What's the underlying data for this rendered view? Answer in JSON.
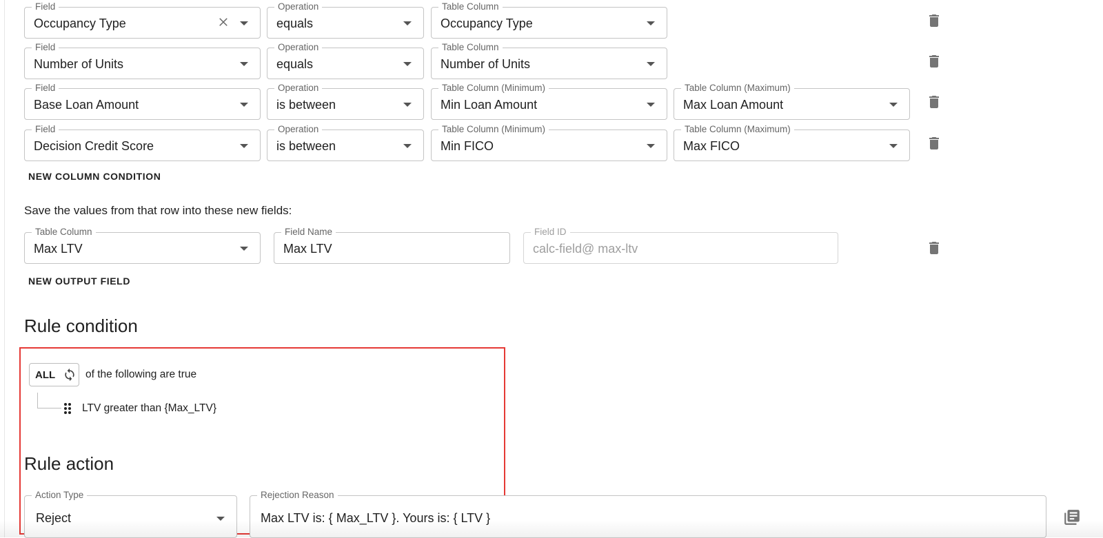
{
  "column_conditions": [
    {
      "field": {
        "label": "Field",
        "value": "Occupancy Type"
      },
      "operation": {
        "label": "Operation",
        "value": "equals"
      },
      "column": {
        "label": "Table Column",
        "value": "Occupancy Type"
      }
    },
    {
      "field": {
        "label": "Field",
        "value": "Number of Units"
      },
      "operation": {
        "label": "Operation",
        "value": "equals"
      },
      "column": {
        "label": "Table Column",
        "value": "Number of Units"
      }
    },
    {
      "field": {
        "label": "Field",
        "value": "Base Loan Amount"
      },
      "operation": {
        "label": "Operation",
        "value": "is between"
      },
      "column_min": {
        "label": "Table Column (Minimum)",
        "value": "Min Loan Amount"
      },
      "column_max": {
        "label": "Table Column (Maximum)",
        "value": "Max Loan Amount"
      }
    },
    {
      "field": {
        "label": "Field",
        "value": "Decision Credit Score"
      },
      "operation": {
        "label": "Operation",
        "value": "is between"
      },
      "column_min": {
        "label": "Table Column (Minimum)",
        "value": "Min FICO"
      },
      "column_max": {
        "label": "Table Column (Maximum)",
        "value": "Max FICO"
      }
    }
  ],
  "new_column_condition_label": "NEW COLUMN CONDITION",
  "save_values_text": "Save the values from that row into these new fields:",
  "output_field": {
    "column": {
      "label": "Table Column",
      "value": "Max LTV"
    },
    "field_name": {
      "label": "Field Name",
      "value": "Max LTV"
    },
    "field_id": {
      "label": "Field ID",
      "value": "calc-field@  max-ltv"
    }
  },
  "new_output_field_label": "NEW OUTPUT FIELD",
  "rule_condition": {
    "title": "Rule condition",
    "toggle_label": "ALL",
    "suffix_text": "of the following are true",
    "conditions": [
      "LTV greater than {Max_LTV}"
    ]
  },
  "rule_action": {
    "title": "Rule action",
    "action_type": {
      "label": "Action Type",
      "value": "Reject"
    },
    "rejection_reason": {
      "label": "Rejection Reason",
      "value": "Max LTV is: { Max_LTV }. Yours is: { LTV }"
    }
  },
  "colors": {
    "highlight_border": "#e53935",
    "icon": "#757575"
  }
}
